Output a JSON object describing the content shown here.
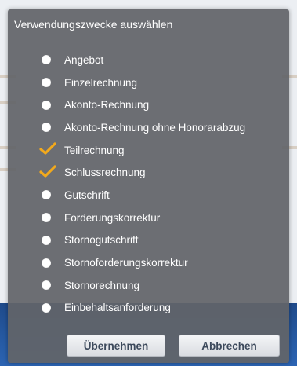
{
  "dialog": {
    "title": "Verwendungszwecke auswählen",
    "options": [
      {
        "label": "Angebot",
        "checked": false
      },
      {
        "label": "Einzelrechnung",
        "checked": false
      },
      {
        "label": "Akonto-Rechnung",
        "checked": false
      },
      {
        "label": "Akonto-Rechnung ohne Honorarabzug",
        "checked": false
      },
      {
        "label": "Teilrechnung",
        "checked": true
      },
      {
        "label": "Schlussrechnung",
        "checked": true
      },
      {
        "label": "Gutschrift",
        "checked": false
      },
      {
        "label": "Forderungskorrektur",
        "checked": false
      },
      {
        "label": "Stornogutschrift",
        "checked": false
      },
      {
        "label": "Stornoforderungskorrektur",
        "checked": false
      },
      {
        "label": "Stornorechnung",
        "checked": false
      },
      {
        "label": "Einbehaltsanforderung",
        "checked": false
      }
    ],
    "apply_label": "Übernehmen",
    "cancel_label": "Abbrechen"
  },
  "colors": {
    "checkmark": "#f2a91c",
    "dialog_bg": "#626468",
    "radio": "#ffffff"
  }
}
